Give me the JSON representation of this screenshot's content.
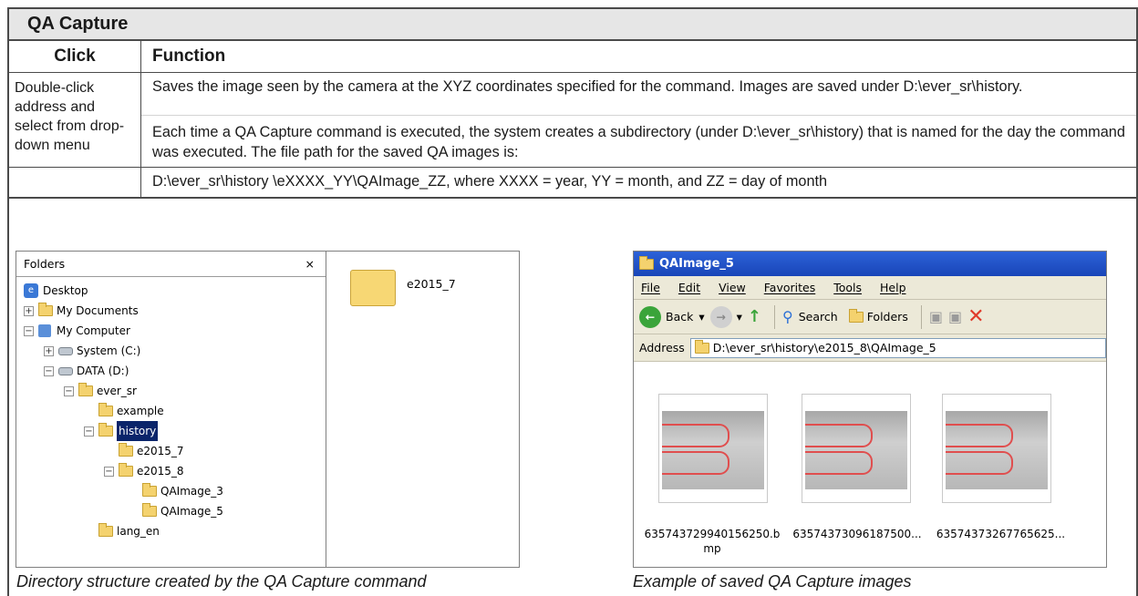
{
  "title": "QA Capture",
  "headers": {
    "click": "Click",
    "function": "Function"
  },
  "row": {
    "click": "Double-click address and select from drop-down menu",
    "para1": "Saves the image seen by the camera at the XYZ coordinates specified for the command. Images are saved under D:\\ever_sr\\history.",
    "para2": "Each time a QA Capture command is executed, the system creates a subdirectory (under D:\\ever_sr\\history) that is named for the day the command was executed. The file path for the saved QA images is:",
    "para3": "D:\\ever_sr\\history \\eXXXX_YY\\QAImage_ZZ, where XXXX = year, YY = month, and ZZ = day of month"
  },
  "explorer_left": {
    "pane_title": "Folders",
    "close": "×",
    "tree": {
      "desktop": "Desktop",
      "my_documents": "My Documents",
      "my_computer": "My Computer",
      "system": "System (C:)",
      "data": "DATA (D:)",
      "ever_sr": "ever_sr",
      "example": "example",
      "history": "history",
      "e2015_7": "e2015_7",
      "e2015_8": "e2015_8",
      "qa3": "QAImage_3",
      "qa5": "QAImage_5",
      "lang": "lang_en"
    },
    "content_folder": "e2015_7"
  },
  "explorer_right": {
    "window_title": "QAImage_5",
    "menu": [
      "File",
      "Edit",
      "View",
      "Favorites",
      "Tools",
      "Help"
    ],
    "back": "Back",
    "search": "Search",
    "folders": "Folders",
    "address_label": "Address",
    "address_value": "D:\\ever_sr\\history\\e2015_8\\QAImage_5",
    "files": [
      "635743729940156250.b mp",
      "63574373096187500...",
      "63574373267765625..."
    ]
  },
  "captions": {
    "left": "Directory structure created by the QA Capture command",
    "right": "Example of saved QA Capture images"
  }
}
